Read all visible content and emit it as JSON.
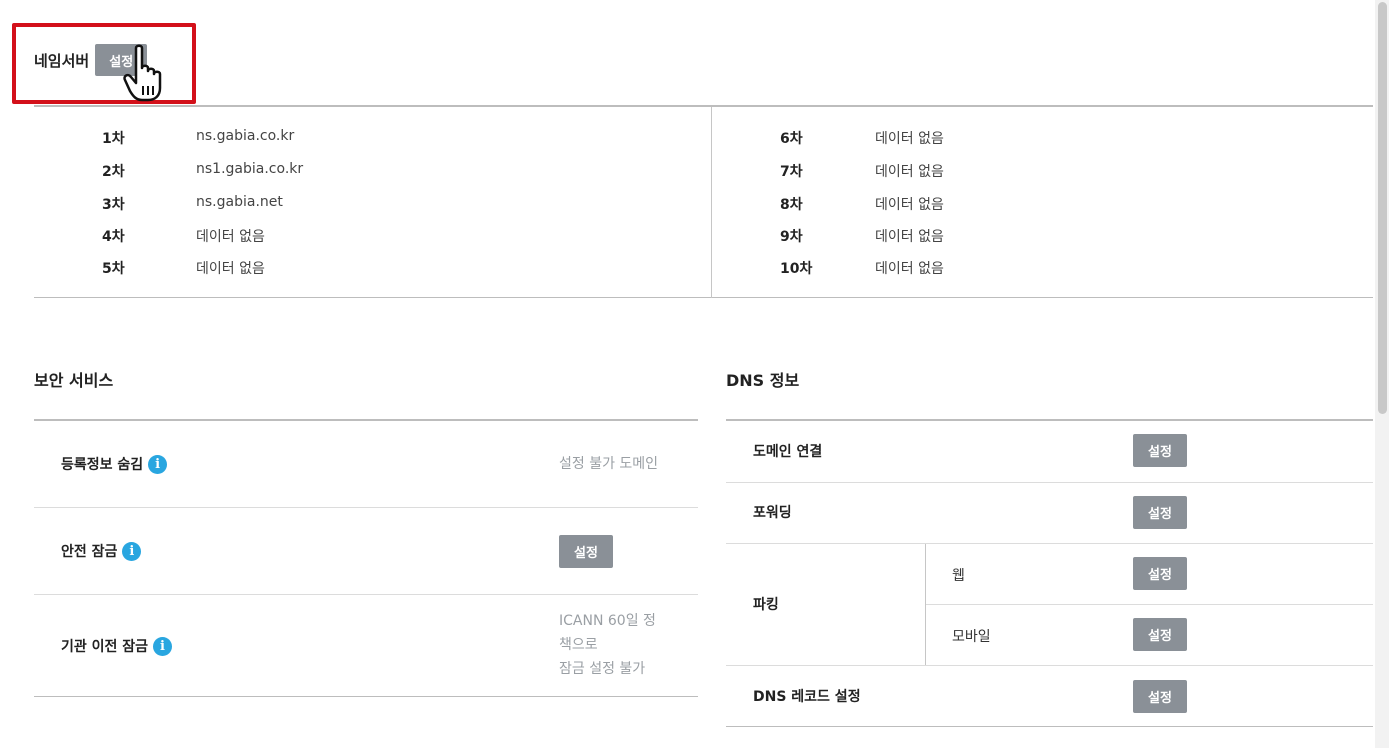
{
  "nameserver": {
    "title": "네임서버",
    "set_label": "설정",
    "left": [
      {
        "order": "1차",
        "value": "ns.gabia.co.kr"
      },
      {
        "order": "2차",
        "value": "ns1.gabia.co.kr"
      },
      {
        "order": "3차",
        "value": "ns.gabia.net"
      },
      {
        "order": "4차",
        "value": "데이터 없음"
      },
      {
        "order": "5차",
        "value": "데이터 없음"
      }
    ],
    "right": [
      {
        "order": "6차",
        "value": "데이터 없음"
      },
      {
        "order": "7차",
        "value": "데이터 없음"
      },
      {
        "order": "8차",
        "value": "데이터 없음"
      },
      {
        "order": "9차",
        "value": "데이터 없음"
      },
      {
        "order": "10차",
        "value": "데이터 없음"
      }
    ]
  },
  "security": {
    "title": "보안 서비스",
    "rows": [
      {
        "label": "등록정보 숨김",
        "status": "설정 불가 도메인"
      },
      {
        "label": "안전 잠금",
        "button": "설정"
      },
      {
        "label": "기관 이전 잠금",
        "status_lines": [
          "ICANN 60일 정",
          "책으로",
          "잠금 설정 불가"
        ]
      }
    ]
  },
  "dns": {
    "title": "DNS 정보",
    "domain_link": {
      "label": "도메인 연결",
      "button": "설정"
    },
    "forwarding": {
      "label": "포워딩",
      "button": "설정"
    },
    "parking": {
      "label": "파킹",
      "web": "웹",
      "mobile": "모바일",
      "web_button": "설정",
      "mobile_button": "설정"
    },
    "dns_record": {
      "label": "DNS 레코드 설정",
      "button": "설정"
    }
  },
  "icons": {
    "info": "info-icon",
    "cursor": "hand-pointer-icon"
  },
  "colors": {
    "highlight": "#d3101a",
    "button": "#8a9097",
    "info": "#29a6e0"
  }
}
